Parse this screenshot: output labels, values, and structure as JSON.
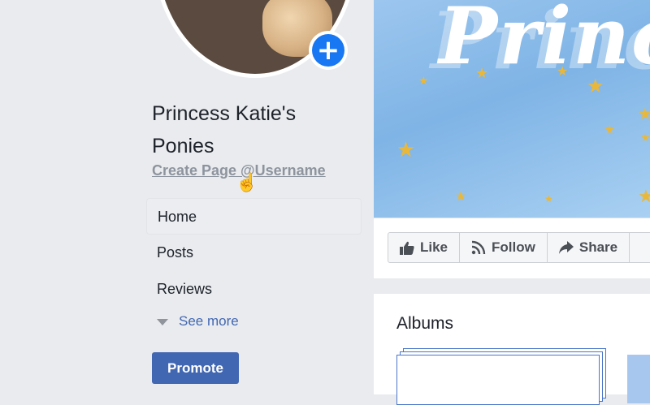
{
  "page": {
    "name": "Princess Katie's Ponies",
    "username_link": "Create Page @Username"
  },
  "nav": {
    "items": [
      {
        "label": "Home",
        "active": true
      },
      {
        "label": "Posts"
      },
      {
        "label": "Reviews"
      }
    ],
    "see_more": "See more"
  },
  "promote_label": "Promote",
  "add_photo_icon": "+",
  "cover": {
    "title_text": "Prince"
  },
  "actions": {
    "like": "Like",
    "follow": "Follow",
    "share": "Share"
  },
  "albums": {
    "title": "Albums"
  },
  "colors": {
    "accent": "#4267b2",
    "background": "#e9ebee",
    "add_button": "#1877f2"
  }
}
